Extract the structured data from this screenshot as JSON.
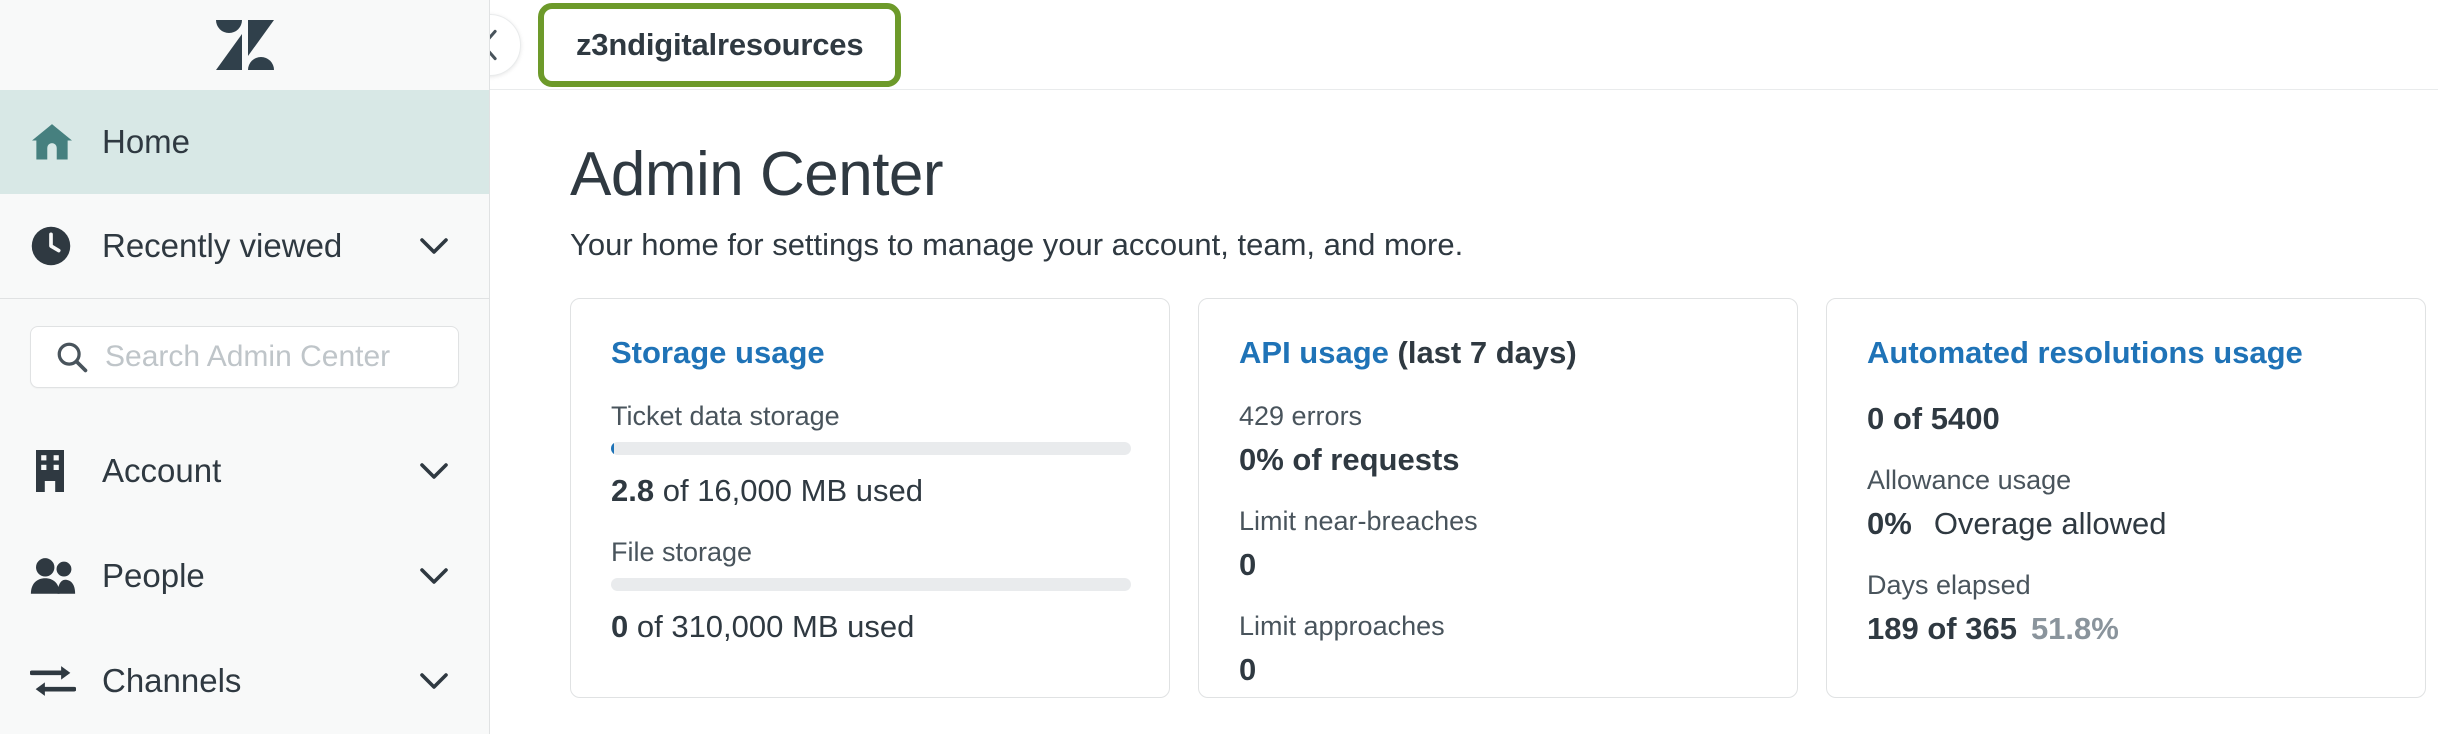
{
  "sidebar": {
    "logo": "zendesk-logo",
    "search": {
      "placeholder": "Search Admin Center",
      "value": "",
      "icon": "search-icon"
    },
    "primary_items": [
      {
        "label": "Home",
        "icon": "home-icon",
        "active": true,
        "chevron": false
      },
      {
        "label": "Recently viewed",
        "icon": "clock-icon",
        "active": false,
        "chevron": true
      }
    ],
    "group_items": [
      {
        "label": "Account",
        "icon": "building-icon",
        "chevron": true
      },
      {
        "label": "People",
        "icon": "people-icon",
        "chevron": true
      },
      {
        "label": "Channels",
        "icon": "channels-arrows-icon",
        "chevron": true
      }
    ]
  },
  "topbar": {
    "collapse_icon": "chevron-left-icon",
    "tab_label": "z3ndigitalresources",
    "highlight_color": "#6d9a2a"
  },
  "main": {
    "title": "Admin Center",
    "subtitle": "Your home for settings to manage your account, team, and more.",
    "cards": [
      {
        "title": "Storage usage",
        "title_suffix": "",
        "rows": [
          {
            "type": "bar-metric",
            "label": "Ticket data storage",
            "percent": 0.6,
            "value_bold": "2.8",
            "value_rest": " of 16,000 MB used"
          },
          {
            "type": "bar-metric",
            "label": "File storage",
            "percent": 0,
            "value_bold": "0",
            "value_rest": " of 310,000 MB used"
          }
        ]
      },
      {
        "title": "API usage",
        "title_suffix": " (last 7 days)",
        "rows": [
          {
            "type": "metric",
            "label": "429 errors",
            "value_bold": "0% of requests",
            "value_rest": ""
          },
          {
            "type": "metric",
            "label": "Limit near-breaches",
            "value_bold": "0",
            "value_rest": ""
          },
          {
            "type": "metric",
            "label": "Limit approaches",
            "value_bold": "0",
            "value_rest": ""
          }
        ]
      },
      {
        "title": "Automated resolutions usage",
        "title_suffix": "",
        "rows": [
          {
            "type": "metric",
            "label": "",
            "value_bold": "0 of 5400",
            "value_rest": ""
          },
          {
            "type": "metric",
            "label": "Allowance usage",
            "value_bold": "0%",
            "value_rest": "Overage allowed"
          },
          {
            "type": "metric",
            "label": "Days elapsed",
            "value_bold": "189 of 365",
            "value_muted": "51.8%"
          }
        ]
      }
    ]
  },
  "colors": {
    "link_blue": "#1f73b7",
    "active_bg": "#d8e8e6",
    "active_icon": "#3e7a7a",
    "highlight_green": "#6d9a2a",
    "text": "#2f3941"
  }
}
